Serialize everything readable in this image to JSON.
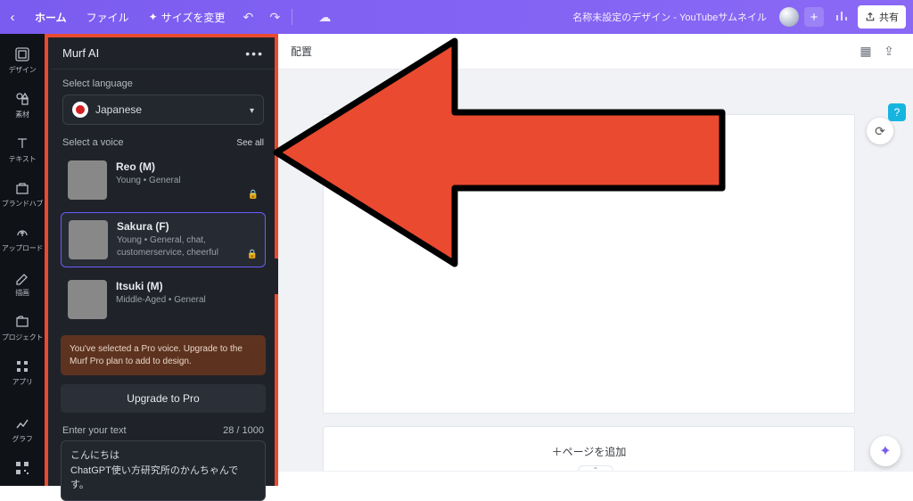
{
  "topbar": {
    "home": "ホーム",
    "file": "ファイル",
    "resize": "サイズを変更",
    "title": "名称未設定のデザイン - YouTubeサムネイル",
    "share": "共有"
  },
  "rail": {
    "items": [
      {
        "label": "デザイン"
      },
      {
        "label": "素材"
      },
      {
        "label": "テキスト"
      },
      {
        "label": "ブランドハブ"
      },
      {
        "label": "アップロード"
      },
      {
        "label": "描画"
      },
      {
        "label": "プロジェクト"
      },
      {
        "label": "アプリ"
      },
      {
        "label": "グラフ"
      }
    ]
  },
  "panel": {
    "title": "Murf AI",
    "select_language_label": "Select language",
    "language": "Japanese",
    "select_voice_label": "Select a voice",
    "see_all": "See all",
    "voices": [
      {
        "name": "Reo (M)",
        "meta": "Young  •  General"
      },
      {
        "name": "Sakura (F)",
        "meta": "Young  •  General, chat, customerservice, cheerful"
      },
      {
        "name": "Itsuki (M)",
        "meta": "Middle-Aged  •  General"
      }
    ],
    "pro_notice": "You've selected a Pro voice. Upgrade to the Murf Pro plan to add to design.",
    "upgrade": "Upgrade to Pro",
    "enter_text_label": "Enter your text",
    "char_count": "28 / 1000",
    "text_value": "こんにちは\nChatGPT使い方研究所のかんちゃんです。"
  },
  "subbar": {
    "arrange": "配置"
  },
  "canvas": {
    "add_page": "＋ページを追加"
  }
}
